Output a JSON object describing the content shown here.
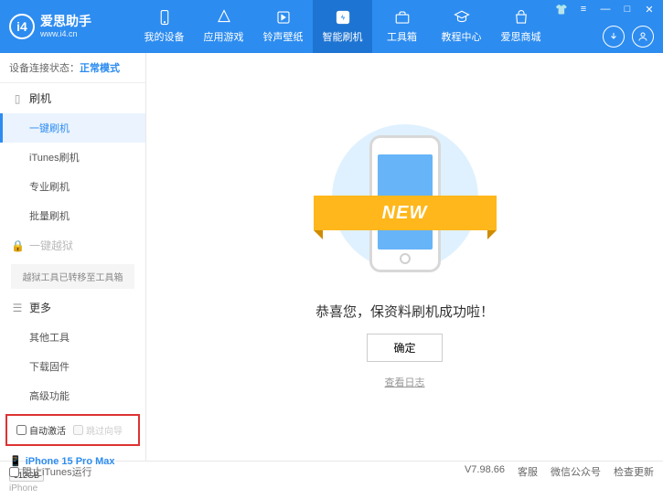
{
  "app": {
    "title": "爱思助手",
    "url": "www.i4.cn"
  },
  "nav": [
    {
      "label": "我的设备"
    },
    {
      "label": "应用游戏"
    },
    {
      "label": "铃声壁纸"
    },
    {
      "label": "智能刷机"
    },
    {
      "label": "工具箱"
    },
    {
      "label": "教程中心"
    },
    {
      "label": "爱思商城"
    }
  ],
  "sidebar": {
    "status_label": "设备连接状态：",
    "status_value": "正常模式",
    "flash_section": "刷机",
    "flash_items": [
      "一键刷机",
      "iTunes刷机",
      "专业刷机",
      "批量刷机"
    ],
    "jailbreak_section": "一键越狱",
    "jailbreak_note": "越狱工具已转移至工具箱",
    "more_section": "更多",
    "more_items": [
      "其他工具",
      "下载固件",
      "高级功能"
    ],
    "chk_auto_activate": "自动激活",
    "chk_skip_guide": "跳过向导",
    "device": {
      "name": "iPhone 15 Pro Max",
      "storage": "512GB",
      "type": "iPhone"
    }
  },
  "main": {
    "ribbon": "NEW",
    "success": "恭喜您，保资料刷机成功啦！",
    "ok": "确定",
    "view_log": "查看日志"
  },
  "footer": {
    "block_itunes": "阻止iTunes运行",
    "version": "V7.98.66",
    "links": [
      "客服",
      "微信公众号",
      "检查更新"
    ]
  }
}
